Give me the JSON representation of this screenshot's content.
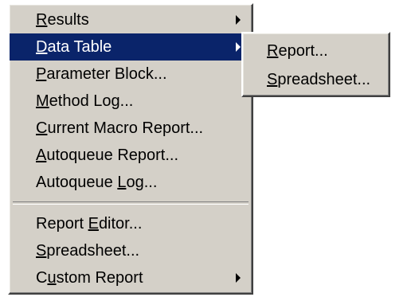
{
  "main_menu": {
    "items": [
      {
        "pre": "",
        "accel": "R",
        "post": "esults",
        "submenu": true,
        "highlighted": false
      },
      {
        "pre": "",
        "accel": "D",
        "post": "ata Table",
        "submenu": true,
        "highlighted": true
      },
      {
        "pre": "",
        "accel": "P",
        "post": "arameter Block...",
        "submenu": false,
        "highlighted": false
      },
      {
        "pre": "",
        "accel": "M",
        "post": "ethod Log...",
        "submenu": false,
        "highlighted": false
      },
      {
        "pre": "",
        "accel": "C",
        "post": "urrent Macro Report...",
        "submenu": false,
        "highlighted": false
      },
      {
        "pre": "",
        "accel": "A",
        "post": "utoqueue Report...",
        "submenu": false,
        "highlighted": false
      },
      {
        "pre": "Autoqueue ",
        "accel": "L",
        "post": "og...",
        "submenu": false,
        "highlighted": false
      },
      {
        "pre": "Report ",
        "accel": "E",
        "post": "ditor...",
        "submenu": false,
        "highlighted": false
      },
      {
        "pre": "",
        "accel": "S",
        "post": "preadsheet...",
        "submenu": false,
        "highlighted": false
      },
      {
        "pre": "C",
        "accel": "u",
        "post": "stom Report",
        "submenu": true,
        "highlighted": false
      }
    ]
  },
  "sub_menu": {
    "items": [
      {
        "pre": "",
        "accel": "R",
        "post": "eport..."
      },
      {
        "pre": "",
        "accel": "S",
        "post": "preadsheet..."
      }
    ]
  },
  "colors": {
    "menu_face": "#d4d0c8",
    "highlight": "#0a246a",
    "highlight_text": "#ffffff"
  },
  "icons": {
    "submenu_arrow": "triangle-right-icon"
  }
}
